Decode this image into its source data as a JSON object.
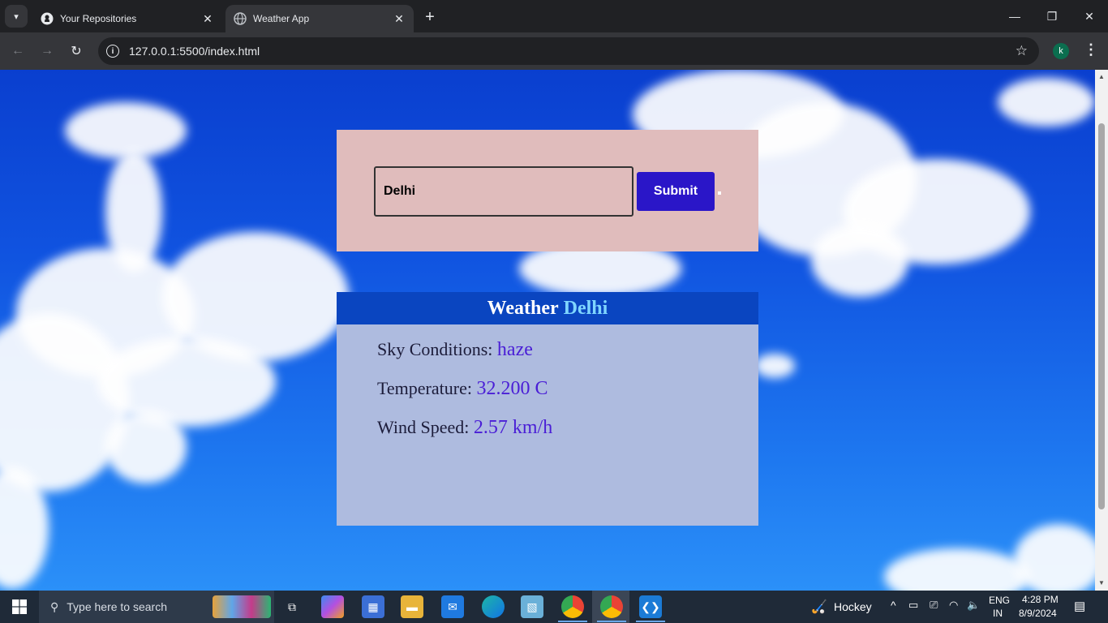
{
  "browser": {
    "tabs": [
      {
        "title": "Your Repositories",
        "icon": "github-icon",
        "active": false
      },
      {
        "title": "Weather App",
        "icon": "globe-icon",
        "active": true
      }
    ],
    "url": "127.0.0.1:5500/index.html",
    "profile_initial": "k"
  },
  "page": {
    "search": {
      "value": "Delhi",
      "submit_label": "Submit"
    },
    "card": {
      "heading": "Weather",
      "city": "Delhi",
      "sky_label": "Sky Conditions:",
      "sky_value": "haze",
      "temp_label": "Temperature:",
      "temp_value": "32.200 C",
      "wind_label": "Wind Speed:",
      "wind_value": "2.57 km/h"
    }
  },
  "taskbar": {
    "search_placeholder": "Type here to search",
    "weather_widget": "Hockey",
    "language": "ENG",
    "region": "IN",
    "time": "4:28 PM",
    "date": "8/9/2024"
  },
  "colors": {
    "search_panel_bg": "#e0bcbc",
    "submit_bg": "#2a16c8",
    "card_header_bg": "#0a45c0",
    "card_body_bg": "#aebbdf",
    "city_accent": "#7fd6ff",
    "value_text": "#4a1ed6"
  }
}
